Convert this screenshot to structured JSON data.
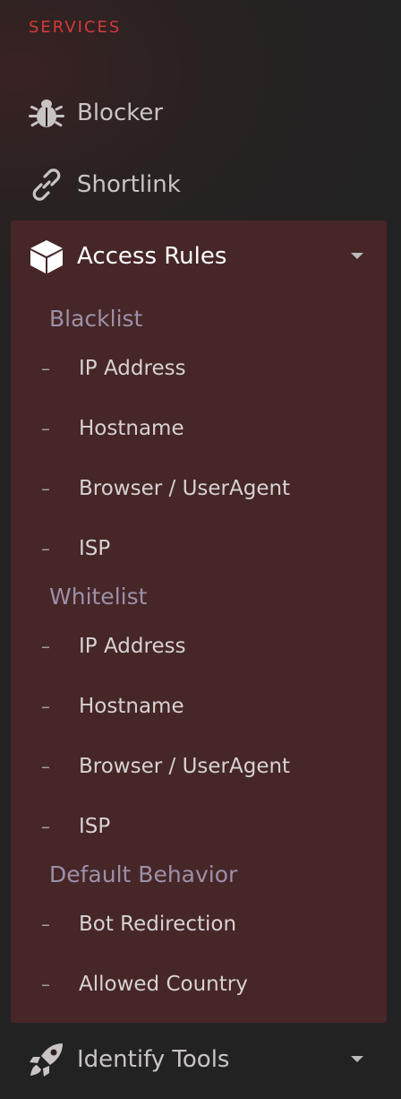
{
  "sidebar": {
    "section_heading": "SERVICES",
    "items": [
      {
        "label": "Blocker",
        "icon": "bug-icon"
      },
      {
        "label": "Shortlink",
        "icon": "link-icon"
      }
    ],
    "access_rules": {
      "label": "Access Rules",
      "icon": "cube-icon",
      "groups": [
        {
          "label": "Blacklist",
          "items": [
            "IP Address",
            "Hostname",
            "Browser / UserAgent",
            "ISP"
          ]
        },
        {
          "label": "Whitelist",
          "items": [
            "IP Address",
            "Hostname",
            "Browser / UserAgent",
            "ISP"
          ]
        },
        {
          "label": "Default Behavior",
          "items": [
            "Bot Redirection",
            "Allowed Country"
          ]
        }
      ]
    },
    "identify_tools": {
      "label": "Identify Tools",
      "icon": "rocket-icon"
    },
    "colors": {
      "heading": "#d43a3a",
      "panel_bg": "#462627",
      "group_label": "#9c90a8"
    }
  }
}
